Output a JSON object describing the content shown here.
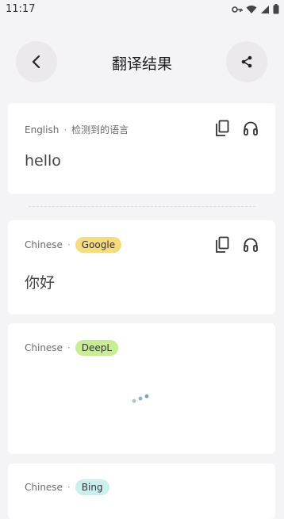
{
  "status_bar": {
    "time": "11:17"
  },
  "header": {
    "title": "翻译结果",
    "back_icon": "chevron-left-icon",
    "share_icon": "share-icon"
  },
  "source": {
    "language": "English",
    "detected_label": "检测到的语言",
    "text": "hello"
  },
  "results": [
    {
      "language": "Chinese",
      "engine": "Google",
      "text": "你好",
      "color": "#f7dc7d"
    },
    {
      "language": "Chinese",
      "engine": "DeepL",
      "text": "",
      "loading": true,
      "color": "#c7ee93"
    },
    {
      "language": "Chinese",
      "engine": "Bing",
      "text": "",
      "color": "#c8f0ee"
    }
  ],
  "separator": "·"
}
